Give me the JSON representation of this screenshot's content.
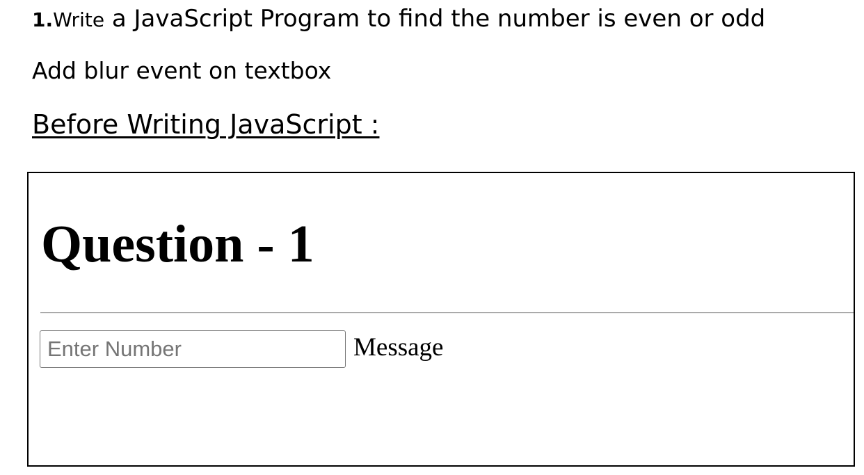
{
  "document": {
    "task_number": "1.",
    "task_word": "Write",
    "task_text": " a JavaScript Program to find the number is even or odd",
    "instruction": "Add blur event on textbox",
    "section_heading": "Before Writing JavaScript :"
  },
  "browser_page": {
    "heading": "Question - 1",
    "number_input": {
      "placeholder": "Enter Number",
      "value": ""
    },
    "message": "Message"
  }
}
